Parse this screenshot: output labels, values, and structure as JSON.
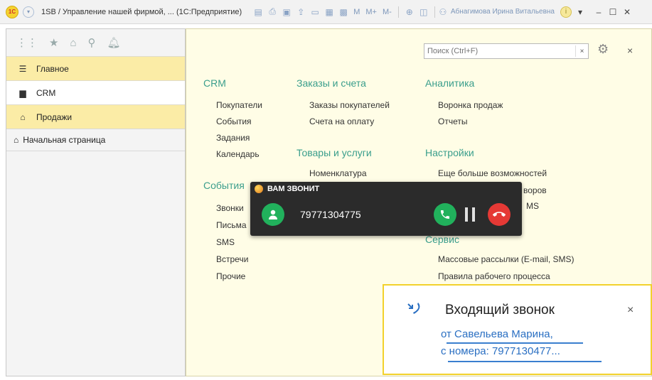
{
  "titlebar": {
    "logo": "1С",
    "title": "1SB / Управление нашей фирмой, ... (1С:Предприятие)",
    "m": "M",
    "mplus": "M+",
    "mminus": "M-",
    "user": "Абнагимова Ирина Витальевна",
    "info": "i"
  },
  "sidebar": {
    "items": [
      {
        "label": "Главное",
        "icon": "menu-icon"
      },
      {
        "label": "CRM",
        "icon": "contact-card-icon"
      },
      {
        "label": "Продажи",
        "icon": "bank-icon"
      }
    ],
    "start_page": "Начальная страница"
  },
  "search": {
    "placeholder": "Поиск (Ctrl+F)",
    "clear": "×"
  },
  "main_close": "×",
  "sections": {
    "crm": {
      "title": "CRM",
      "links": [
        "Покупатели",
        "События",
        "Задания",
        "Календарь"
      ]
    },
    "orders": {
      "title": "Заказы и счета",
      "links": [
        "Заказы покупателей",
        "Счета на оплату"
      ]
    },
    "analytics": {
      "title": "Аналитика",
      "links": [
        "Воронка продаж",
        "Отчеты"
      ]
    },
    "goods": {
      "title": "Товары и услуги",
      "links": [
        "Номенклатура"
      ]
    },
    "settings": {
      "title": "Настройки",
      "links": [
        "Еще больше возможностей",
        "воров",
        "MS"
      ]
    },
    "events": {
      "title": "События",
      "links": [
        "Звонки",
        "Письма",
        "SMS",
        "Встречи",
        "Прочие"
      ]
    },
    "service": {
      "title": "Сервис",
      "links": [
        "Массовые рассылки (E-mail, SMS)",
        "Правила рабочего процесса"
      ]
    }
  },
  "call": {
    "header": "ВАМ ЗВОНИТ",
    "number": "79771304775"
  },
  "notification": {
    "title": "Входящий звонок",
    "line1": "от Савельева Марина,",
    "line2": "с номера: 7977130477...",
    "close": "×"
  }
}
